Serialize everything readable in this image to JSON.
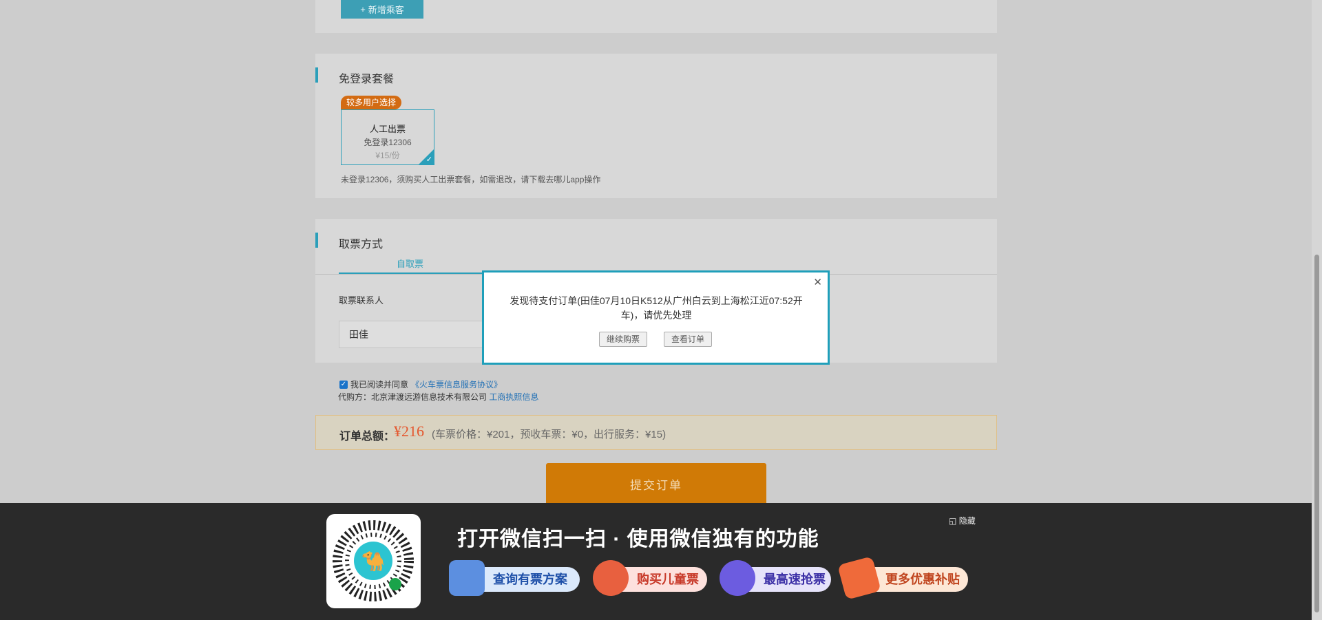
{
  "passenger": {
    "add_label": "新增乘客"
  },
  "package": {
    "title": "免登录套餐",
    "badge": "较多用户选择",
    "name": "人工出票",
    "sub": "免登录12306",
    "price": "¥15/份",
    "note": "未登录12306，须购买人工出票套餐，如需退改，请下载去哪儿app操作"
  },
  "pickup": {
    "title": "取票方式",
    "tab": "自取票",
    "contact_label": "取票联系人",
    "contact_value": "田佳"
  },
  "agreement": {
    "text": "我已阅读并同意",
    "link": "《火车票信息服务协议》",
    "agent_prefix": "代购方：北京津渡远游信息技术有限公司",
    "license_link": "工商执照信息"
  },
  "order": {
    "total_label": "订单总额：",
    "total_value": "¥216",
    "breakdown": "(车票价格：¥201，预收车票：¥0，出行服务：¥15)",
    "submit": "提交订单"
  },
  "dialog": {
    "message": "发现待支付订单(田佳07月10日K512从广州白云到上海松江近07:52开车)，请优先处理",
    "continue": "继续购票",
    "view": "查看订单",
    "close_glyph": "✕"
  },
  "promo": {
    "title": "打开微信扫一扫 · 使用微信独有的功能",
    "hide": "隐藏",
    "items": [
      "查询有票方案",
      "购买儿童票",
      "最高速抢票",
      "更多优惠补贴"
    ]
  },
  "colors": {
    "accent": "#2b9fba",
    "submit": "#d07a06",
    "price": "#e4572e"
  }
}
